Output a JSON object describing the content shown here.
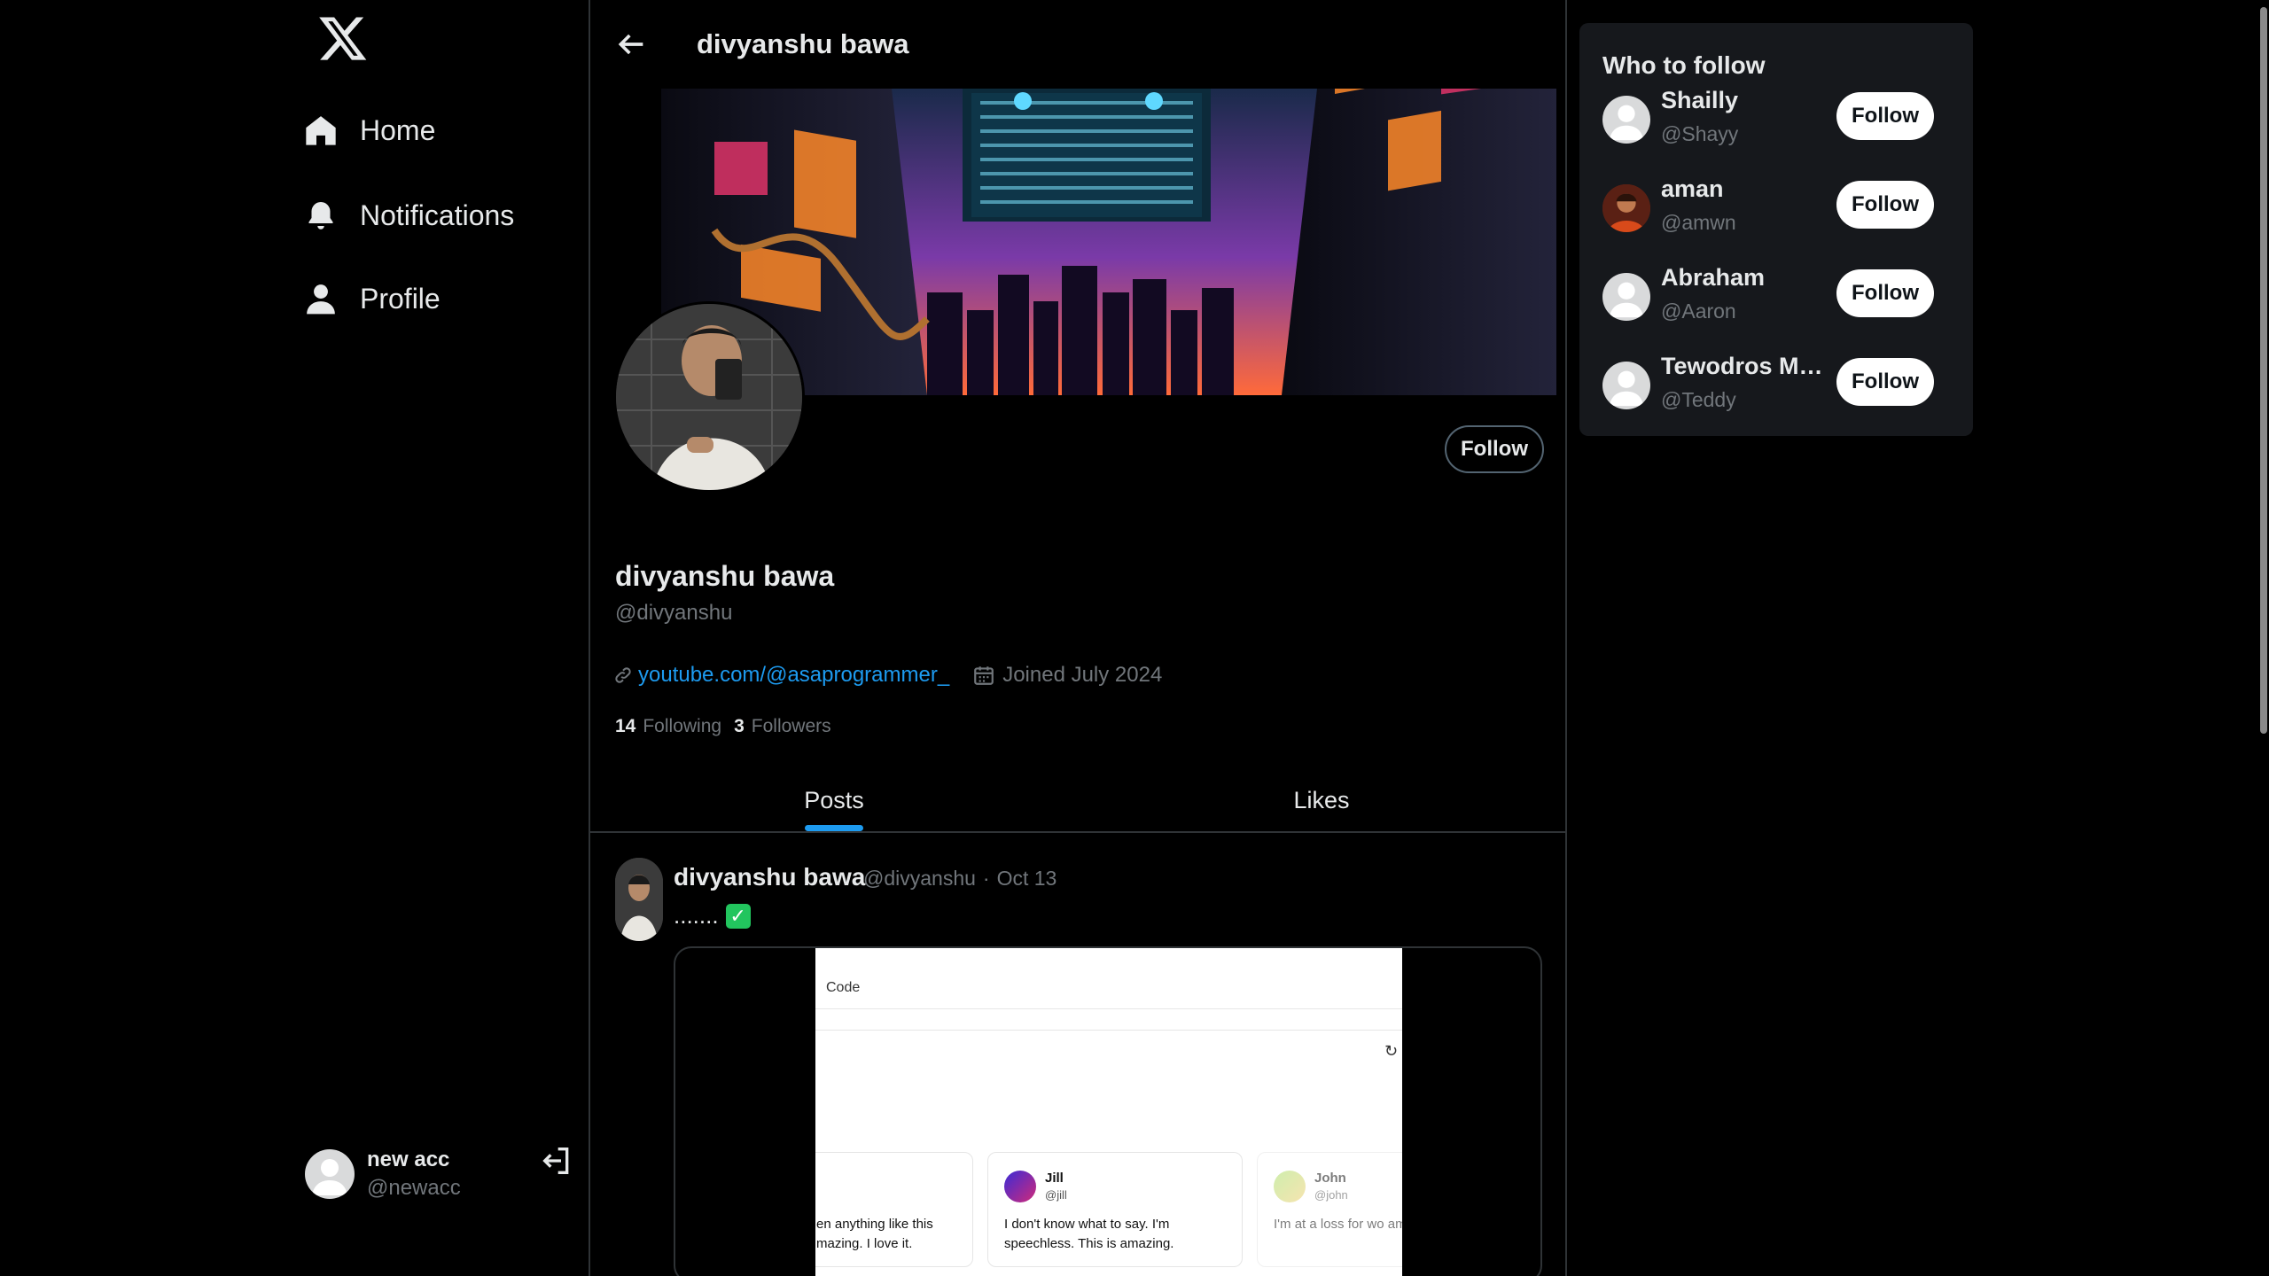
{
  "app": {
    "logo": "X"
  },
  "nav": {
    "items": [
      {
        "label": "Home",
        "icon": "home-icon"
      },
      {
        "label": "Notifications",
        "icon": "bell-icon"
      },
      {
        "label": "Profile",
        "icon": "person-icon"
      }
    ]
  },
  "account": {
    "name": "new acc",
    "handle": "@newacc",
    "action_icon": "logout-icon"
  },
  "header": {
    "title": "divyanshu bawa",
    "back_icon": "arrow-left-icon"
  },
  "profile": {
    "name": "divyanshu bawa",
    "handle": "@divyanshu",
    "follow_label": "Follow",
    "link": "youtube.com/@asaprogrammer_",
    "joined": "Joined July 2024",
    "following_count": "14",
    "following_label": "Following",
    "followers_count": "3",
    "followers_label": "Followers"
  },
  "tabs": [
    {
      "label": "Posts",
      "active": true
    },
    {
      "label": "Likes",
      "active": false
    }
  ],
  "post": {
    "author": "divyanshu bawa",
    "handle": "@divyanshu",
    "separator": "·",
    "date": "Oct 13",
    "text": ".......",
    "emoji": "✓",
    "media": {
      "tab_label": "Code",
      "cards": [
        {
          "name": "",
          "handle": "",
          "body": "en anything like this mazing. I love it."
        },
        {
          "name": "Jill",
          "handle": "@jill",
          "body": "I don't know what to say. I'm speechless. This is amazing."
        },
        {
          "name": "John",
          "handle": "@john",
          "body": "I'm at a loss for wo amazing. I love it."
        }
      ]
    }
  },
  "who_to_follow": {
    "title": "Who to follow",
    "users": [
      {
        "name": "Shailly",
        "handle": "@Shayy",
        "button": "Follow"
      },
      {
        "name": "aman",
        "handle": "@amwn",
        "button": "Follow"
      },
      {
        "name": "Abraham",
        "handle": "@Aaron",
        "button": "Follow"
      },
      {
        "name": "Tewodros Mis...",
        "handle": "@Teddy",
        "button": "Follow"
      }
    ]
  },
  "colors": {
    "accent": "#1d9bf0",
    "background": "#000000",
    "muted": "#71767b",
    "card": "#16181c"
  }
}
